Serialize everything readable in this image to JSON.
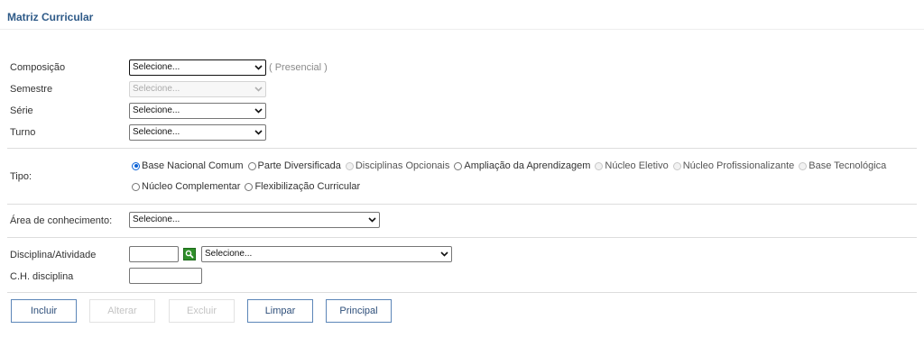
{
  "page": {
    "title": "Matriz Curricular"
  },
  "form": {
    "composicao": {
      "label": "Composição",
      "value": "Selecione...",
      "hint": "( Presencial )"
    },
    "semestre": {
      "label": "Semestre",
      "value": "Selecione..."
    },
    "serie": {
      "label": "Série",
      "value": "Selecione..."
    },
    "turno": {
      "label": "Turno",
      "value": "Selecione..."
    },
    "tipo": {
      "label": "Tipo:",
      "options": [
        {
          "label": "Base Nacional Comum",
          "checked": true,
          "disabled": false
        },
        {
          "label": "Parte Diversificada",
          "checked": false,
          "disabled": false
        },
        {
          "label": "Disciplinas Opcionais",
          "checked": false,
          "disabled": true
        },
        {
          "label": "Ampliação da Aprendizagem",
          "checked": false,
          "disabled": false
        },
        {
          "label": "Núcleo Eletivo",
          "checked": false,
          "disabled": true
        },
        {
          "label": "Núcleo Profissionalizante",
          "checked": false,
          "disabled": true
        },
        {
          "label": "Base Tecnológica",
          "checked": false,
          "disabled": true
        },
        {
          "label": "Núcleo Complementar",
          "checked": false,
          "disabled": false
        },
        {
          "label": "Flexibilização Curricular",
          "checked": false,
          "disabled": false
        }
      ]
    },
    "area": {
      "label": "Área de conhecimento:",
      "value": "Selecione..."
    },
    "disciplina": {
      "label": "Disciplina/Atividade",
      "code_value": "",
      "value": "Selecione..."
    },
    "ch": {
      "label": "C.H. disciplina",
      "value": ""
    }
  },
  "buttons": {
    "incluir": "Incluir",
    "alterar": "Alterar",
    "excluir": "Excluir",
    "limpar": "Limpar",
    "principal": "Principal"
  },
  "colors": {
    "title": "#2e5a88",
    "radio_accent": "#0b62d6",
    "search_button": "#2f8f2a",
    "button_border": "#5c86b8"
  }
}
